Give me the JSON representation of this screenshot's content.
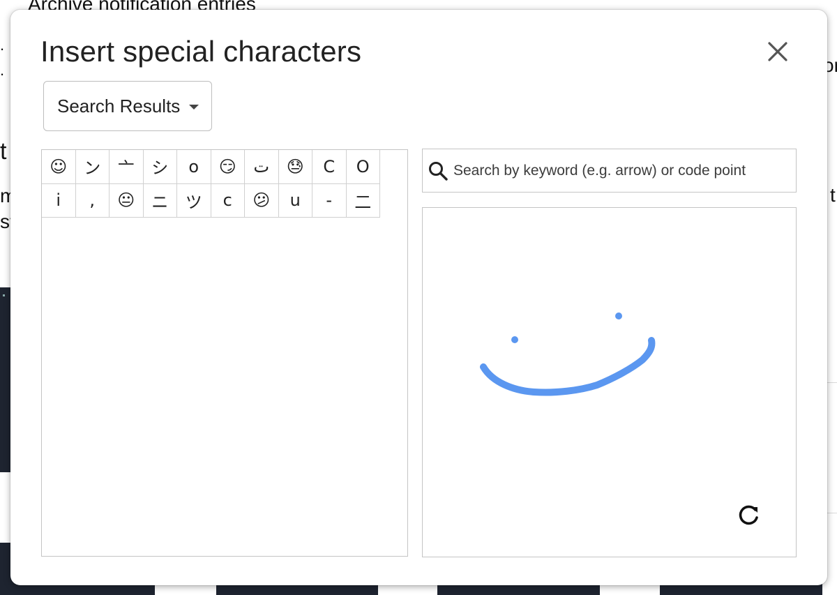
{
  "background": {
    "list_item_text": "Archive notification entries",
    "heading_fragment": "t",
    "line1_fragment": "m",
    "line2_fragment": "st",
    "right_fragment_1": "or",
    "right_fragment_2": "t i"
  },
  "dialog": {
    "title": "Insert special characters",
    "category_selected": "Search Results",
    "search_placeholder": "Search by keyword (e.g. arrow) or code point"
  },
  "characters": [
    "☺",
    "ン",
    "亠",
    "シ",
    "o",
    "😏",
    "ت",
    "😓",
    "C",
    "O",
    "i",
    ",",
    "😐",
    "ニ",
    "ツ",
    "c",
    "😕",
    "u",
    "-",
    "二"
  ],
  "colors": {
    "stroke": "#5b97f0",
    "text": "#222222",
    "border": "#c4c4c4"
  },
  "icons": [
    "close-icon",
    "chevron-down-icon",
    "search-icon",
    "refresh-icon"
  ]
}
